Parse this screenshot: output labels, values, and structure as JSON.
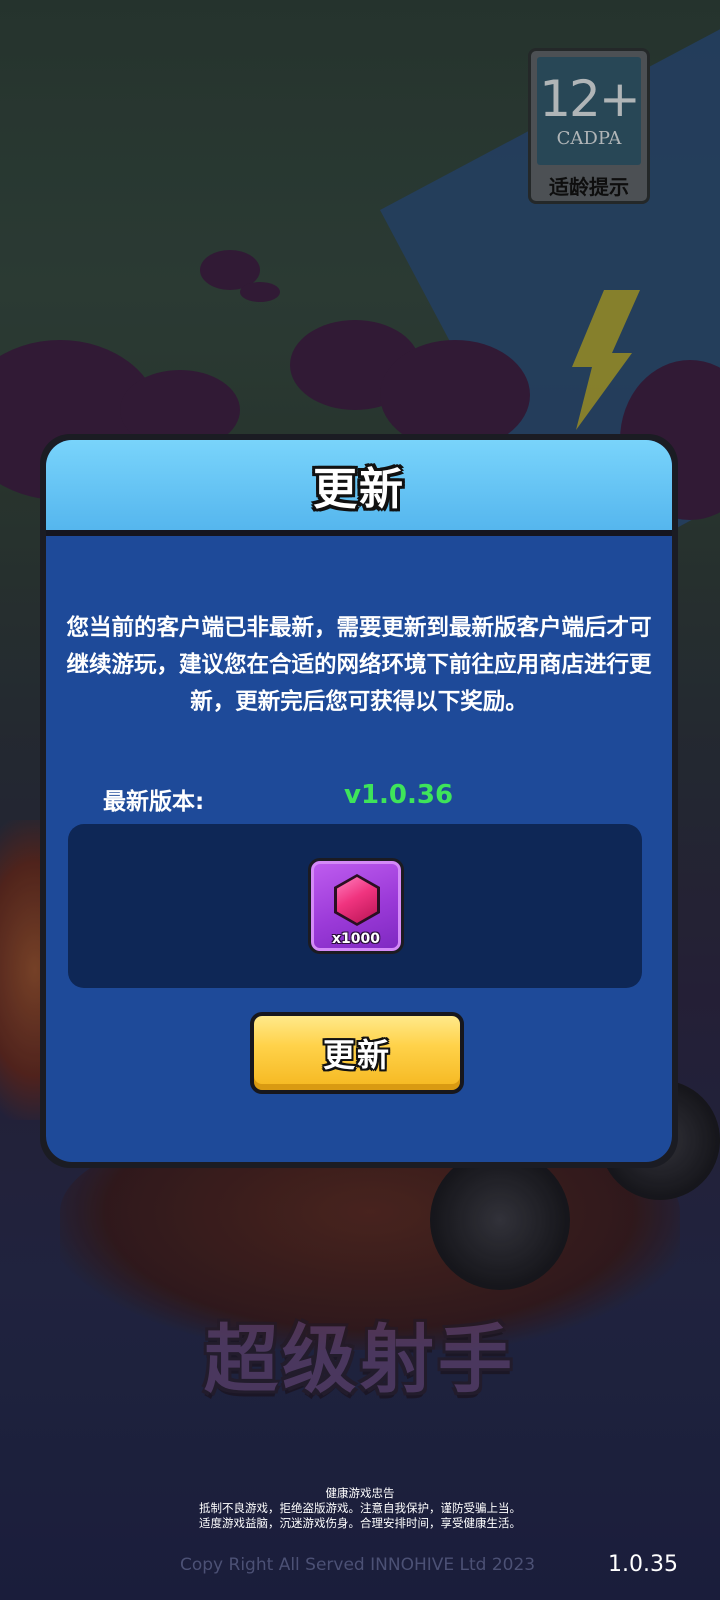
{
  "age_rating": {
    "age": "12+",
    "org": "CADPA",
    "hint": "适龄提示"
  },
  "game_logo": "超级射手",
  "dialog": {
    "title": "更新",
    "message": "您当前的客户端已非最新，需要更新到最新版客户端后才可继续游玩，建议您在合适的网络环境下前往应用商店进行更新，更新完后您可获得以下奖励。",
    "latest_version_label": "最新版本:",
    "latest_version_value": "v1.0.36",
    "reward": {
      "icon": "gem-icon",
      "quantity": "x1000"
    },
    "update_button_label": "更新"
  },
  "footer": {
    "advisory_title": "健康游戏忠告",
    "advisory_line1": "抵制不良游戏，拒绝盗版游戏。注意自我保护，谨防受骗上当。",
    "advisory_line2": "适度游戏益脑，沉迷游戏伤身。合理安排时间，享受健康生活。",
    "copyright": "Copy Right All Served INNOHIVE Ltd 2023",
    "build_version": "1.0.35"
  },
  "colors": {
    "header": "#6cc8f6",
    "dialog_body": "#1e4a99",
    "reward_panel": "#0e2756",
    "version_value": "#3ee45a",
    "button": "#ffd24a"
  }
}
